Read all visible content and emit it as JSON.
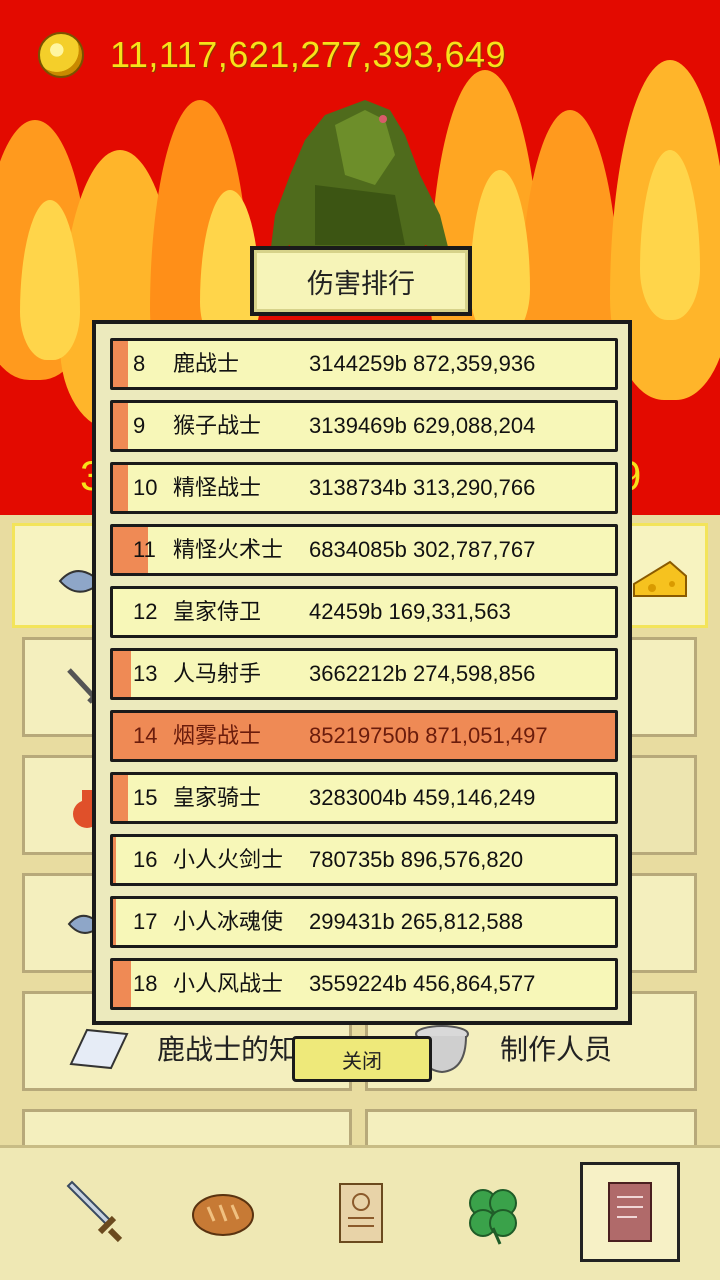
{
  "header": {
    "gold_amount": "11,117,621,277,393,649",
    "coin_icon": "gold-coin-icon"
  },
  "dialog": {
    "title": "伤害排行",
    "close_label": "关闭",
    "rows": [
      {
        "rank": "8",
        "name": "鹿战士",
        "score": "3144259b 872,359,936",
        "bar": 0.03,
        "highlight": false
      },
      {
        "rank": "9",
        "name": "猴子战士",
        "score": "3139469b 629,088,204",
        "bar": 0.03,
        "highlight": false
      },
      {
        "rank": "10",
        "name": "精怪战士",
        "score": "3138734b 313,290,766",
        "bar": 0.03,
        "highlight": false
      },
      {
        "rank": "11",
        "name": "精怪火术士",
        "score": "6834085b 302,787,767",
        "bar": 0.07,
        "highlight": false
      },
      {
        "rank": "12",
        "name": "皇家侍卫",
        "score": "42459b 169,331,563",
        "bar": 0.0,
        "highlight": false
      },
      {
        "rank": "13",
        "name": "人马射手",
        "score": "3662212b 274,598,856",
        "bar": 0.035,
        "highlight": false
      },
      {
        "rank": "14",
        "name": "烟雾战士",
        "score": "85219750b 871,051,497",
        "bar": 1.0,
        "highlight": true
      },
      {
        "rank": "15",
        "name": "皇家骑士",
        "score": "3283004b 459,146,249",
        "bar": 0.03,
        "highlight": false
      },
      {
        "rank": "16",
        "name": "小人火剑士",
        "score": "780735b 896,576,820",
        "bar": 0.008,
        "highlight": false
      },
      {
        "rank": "17",
        "name": "小人冰魂使",
        "score": "299431b 265,812,588",
        "bar": 0.004,
        "highlight": false
      },
      {
        "rank": "18",
        "name": "小人风战士",
        "score": "3559224b 456,864,577",
        "bar": 0.035,
        "highlight": false
      }
    ]
  },
  "background": {
    "tile_left_label": "鹿战士的知识",
    "tile_right_label": "制作人员"
  },
  "nav": [
    {
      "name": "sword-icon"
    },
    {
      "name": "bread-icon"
    },
    {
      "name": "scroll-icon"
    },
    {
      "name": "clover-icon"
    },
    {
      "name": "book-icon",
      "active": true
    }
  ],
  "colors": {
    "accent": "#ef8a55",
    "row_bg": "#f7f7b8",
    "gold_text": "#f7e21a",
    "flame_bg": "#e30a00"
  }
}
